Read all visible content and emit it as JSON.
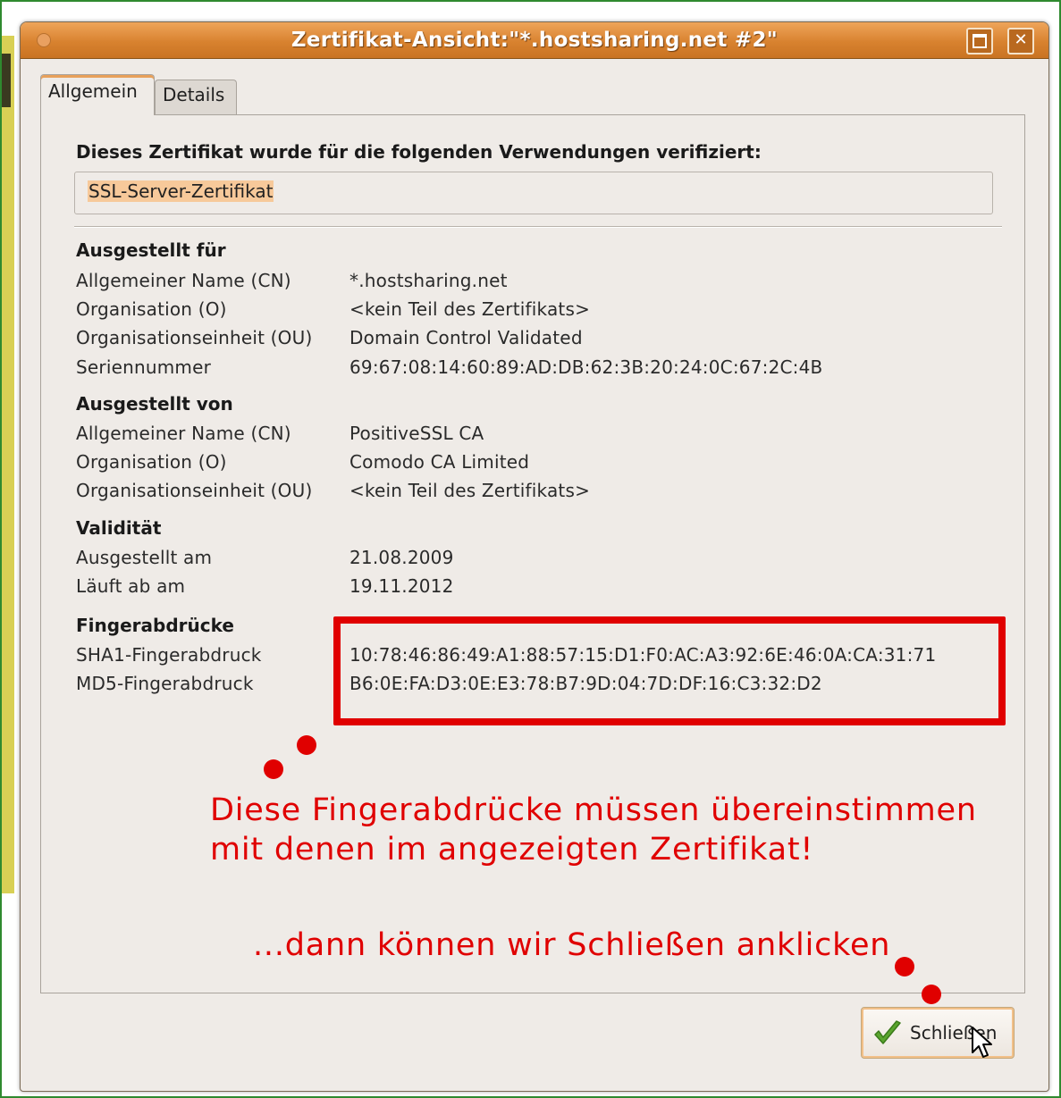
{
  "window": {
    "title": "Zertifikat-Ansicht:\"*.hostsharing.net #2\"",
    "accent_color": "#d8822f"
  },
  "tabs": [
    {
      "label": "Allgemein",
      "active": true
    },
    {
      "label": "Details",
      "active": false
    }
  ],
  "usage": {
    "heading": "Dieses Zertifikat wurde für die folgenden Verwendungen verifiziert:",
    "value": "SSL-Server-Zertifikat"
  },
  "issued_to": {
    "heading": "Ausgestellt für",
    "rows": [
      {
        "label": "Allgemeiner Name (CN)",
        "value": "*.hostsharing.net"
      },
      {
        "label": "Organisation (O)",
        "value": "<kein Teil des Zertifikats>"
      },
      {
        "label": "Organisationseinheit (OU)",
        "value": "Domain Control Validated"
      },
      {
        "label": "Seriennummer",
        "value": "69:67:08:14:60:89:AD:DB:62:3B:20:24:0C:67:2C:4B"
      }
    ]
  },
  "issued_by": {
    "heading": "Ausgestellt von",
    "rows": [
      {
        "label": "Allgemeiner Name (CN)",
        "value": "PositiveSSL CA"
      },
      {
        "label": "Organisation (O)",
        "value": "Comodo CA Limited"
      },
      {
        "label": "Organisationseinheit (OU)",
        "value": "<kein Teil des Zertifikats>"
      }
    ]
  },
  "validity": {
    "heading": "Validität",
    "rows": [
      {
        "label": "Ausgestellt am",
        "value": "21.08.2009"
      },
      {
        "label": "Läuft ab am",
        "value": "19.11.2012"
      }
    ]
  },
  "fingerprints": {
    "heading": "Fingerabdrücke",
    "rows": [
      {
        "label": "SHA1-Fingerabdruck",
        "value": "10:78:46:86:49:A1:88:57:15:D1:F0:AC:A3:92:6E:46:0A:CA:31:71"
      },
      {
        "label": "MD5-Fingerabdruck",
        "value": "B6:0E:FA:D3:0E:E3:78:B7:9D:04:7D:DF:16:C3:32:D2"
      }
    ]
  },
  "annotation": {
    "line1": "Diese Fingerabdrücke müssen übereinstimmen",
    "line2": "mit denen im angezeigten Zertifikat!",
    "line3": "...dann können wir Schließen anklicken",
    "color": "#e00000"
  },
  "buttons": {
    "close_label": "Schließen",
    "close_icon": "check-icon"
  }
}
